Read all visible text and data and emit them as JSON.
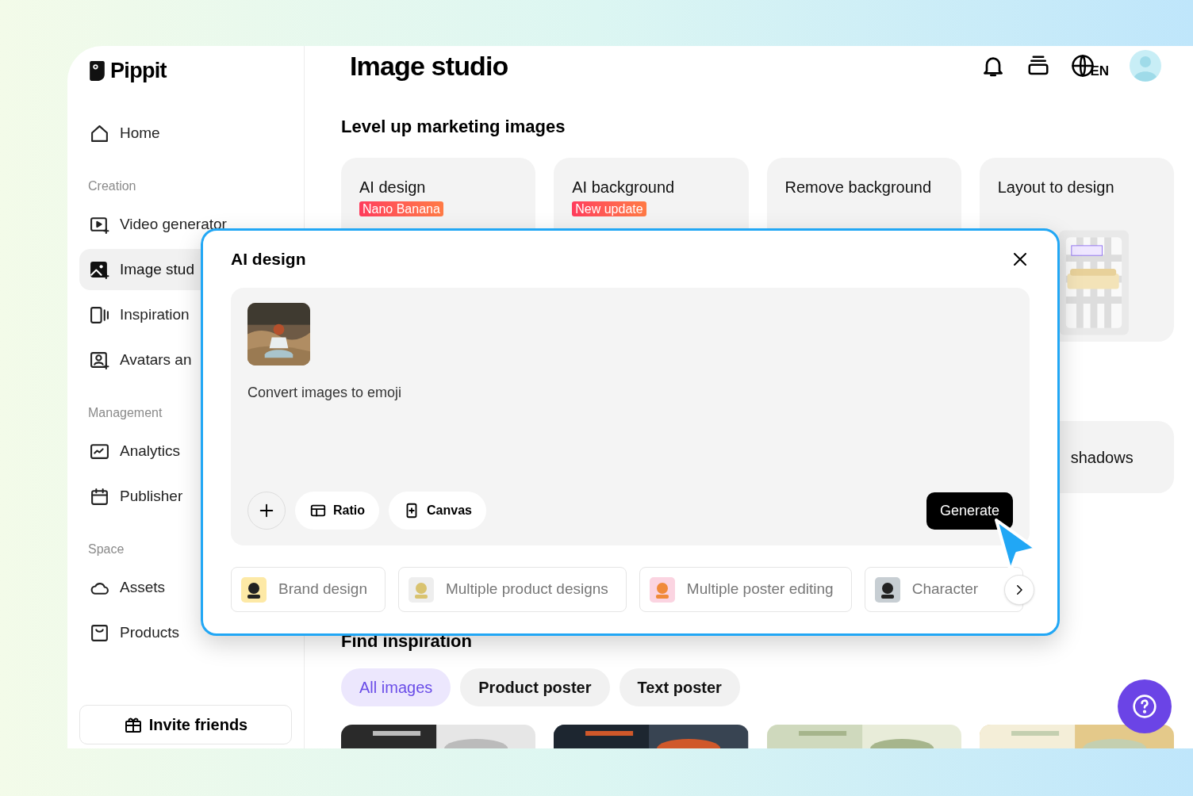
{
  "sidebar": {
    "logo": "Pippit",
    "sections": [
      {
        "items": [
          {
            "label": "Home",
            "selected": false
          }
        ]
      },
      {
        "heading": "Creation",
        "items": [
          {
            "label": "Video generator",
            "selected": false
          },
          {
            "label": "Image stud",
            "selected": true
          },
          {
            "label": "Inspiration",
            "selected": false
          },
          {
            "label": "Avatars an",
            "selected": false
          }
        ]
      },
      {
        "heading": "Management",
        "items": [
          {
            "label": "Analytics",
            "selected": false
          },
          {
            "label": "Publisher",
            "selected": false
          }
        ]
      },
      {
        "heading": "Space",
        "items": [
          {
            "label": "Assets",
            "selected": false
          },
          {
            "label": "Products",
            "selected": false
          }
        ]
      }
    ],
    "invite": "Invite friends"
  },
  "header": {
    "title": "Image studio",
    "language": "EN"
  },
  "section_title": "Level up marketing images",
  "feature_cards": [
    {
      "title": "AI design",
      "badge": "Nano Banana"
    },
    {
      "title": "AI background",
      "badge": "New update"
    },
    {
      "title": "Remove background"
    },
    {
      "title": "Layout to design",
      "kind": "picture"
    }
  ],
  "second_row_card": {
    "title": "shadows"
  },
  "modal": {
    "title": "AI design",
    "prompt": "Convert images to emoji",
    "tools": [
      "Ratio",
      "Canvas"
    ],
    "generate": "Generate",
    "suggestions": [
      "Brand design",
      "Multiple product designs",
      "Multiple poster editing",
      "Character"
    ]
  },
  "inspiration": {
    "title": "Find inspiration",
    "filters": [
      {
        "label": "All images",
        "selected": true
      },
      {
        "label": "Product poster",
        "selected": false
      },
      {
        "label": "Text poster",
        "selected": false
      }
    ]
  }
}
